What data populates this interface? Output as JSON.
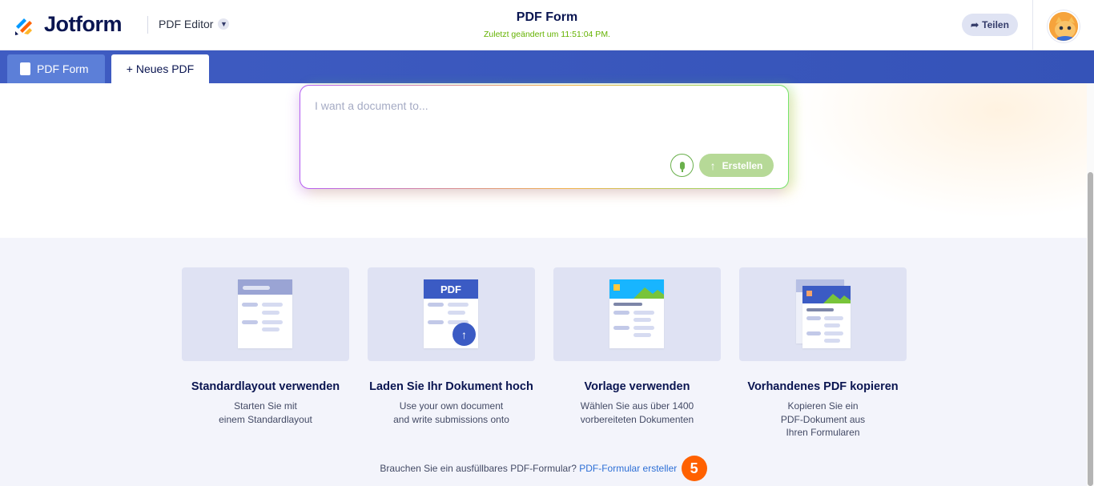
{
  "header": {
    "brand": "Jotform",
    "editor_label": "PDF Editor",
    "doc_title": "PDF Form",
    "saved_status": "Zuletzt geändert um 11:51:04 PM.",
    "share_label": "Teilen"
  },
  "tabs": [
    {
      "label": "PDF Form"
    },
    {
      "label": "+ Neues PDF"
    }
  ],
  "prompt": {
    "placeholder": "I want a document to...",
    "create_label": "Erstellen"
  },
  "cards": [
    {
      "title": "Standardlayout verwenden",
      "desc": [
        "Starten Sie mit",
        "einem Standardlayout"
      ]
    },
    {
      "title": "Laden Sie Ihr Dokument hoch",
      "badge": "PDF",
      "desc": [
        "Use your own document",
        "and write submissions onto"
      ]
    },
    {
      "title": "Vorlage verwenden",
      "desc": [
        "Wählen Sie aus über 1400",
        "vorbereiteten Dokumenten"
      ]
    },
    {
      "title": "Vorhandenes PDF kopieren",
      "desc": [
        "Kopieren Sie ein",
        "PDF-Dokument aus",
        "Ihren Formularen"
      ]
    }
  ],
  "footer": {
    "question": "Brauchen Sie ein ausfüllbares PDF-Formular?",
    "link": "PDF-Formular ersteller",
    "step_badge": "5"
  },
  "colors": {
    "brand_navy": "#0a1551",
    "tab_blue": "#3f5cc2",
    "saved_green": "#64b200",
    "create_green": "#b6d997",
    "badge_orange": "#ff6100",
    "link_blue": "#2d6fd6"
  }
}
